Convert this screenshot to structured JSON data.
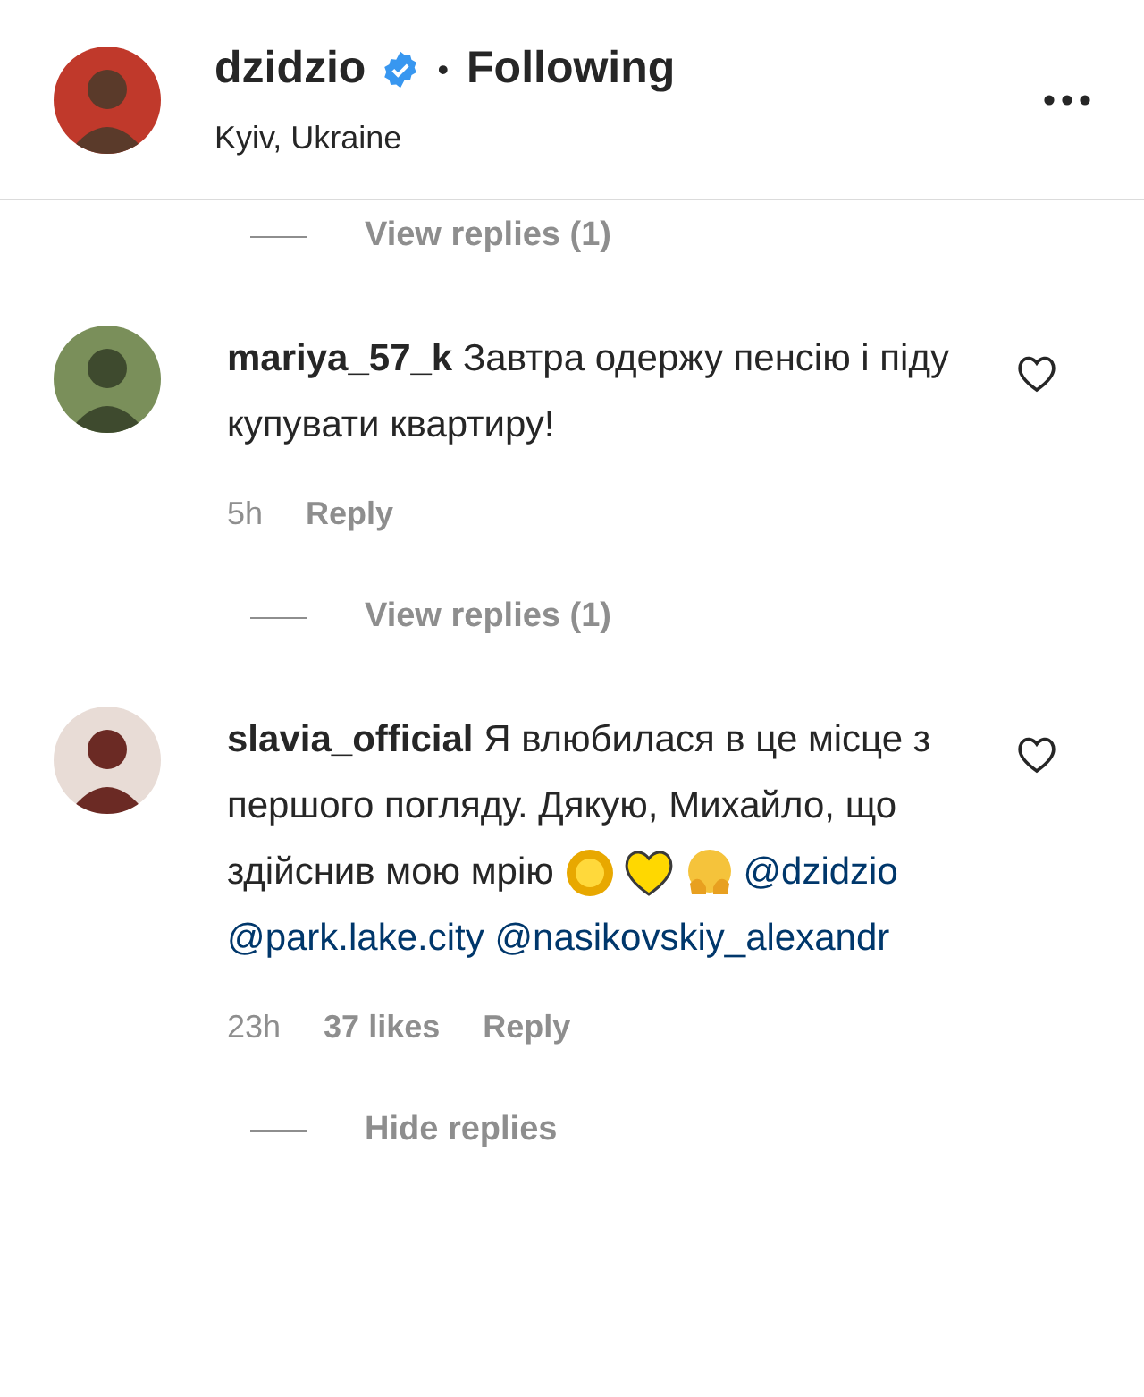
{
  "post_header": {
    "username": "dzidzio",
    "verified": true,
    "separator": "•",
    "follow_status": "Following",
    "location": "Kyiv, Ukraine"
  },
  "cut_replies_toggle": "View replies (1)",
  "comments": [
    {
      "username": "mariya_57_k",
      "text": "Завтра одержу пенсію і піду купувати квартиру!",
      "time": "5h",
      "reply": "Reply",
      "replies_toggle": "View replies (1)",
      "liked": false
    },
    {
      "username": "slavia_official",
      "text": "Я влюбилася в це місце з першого погляду. Дякую, Михайло, що здійснив мою мрію",
      "emoji": [
        {
          "kind": "sun"
        },
        {
          "kind": "heart"
        },
        {
          "kind": "smile"
        }
      ],
      "mentions": [
        "@dzidzio",
        "@park.lake.city",
        "@nasikovskiy_alexandr"
      ],
      "time": "23h",
      "likes": "37 likes",
      "reply": "Reply",
      "replies_toggle": "Hide replies",
      "liked": false
    }
  ]
}
